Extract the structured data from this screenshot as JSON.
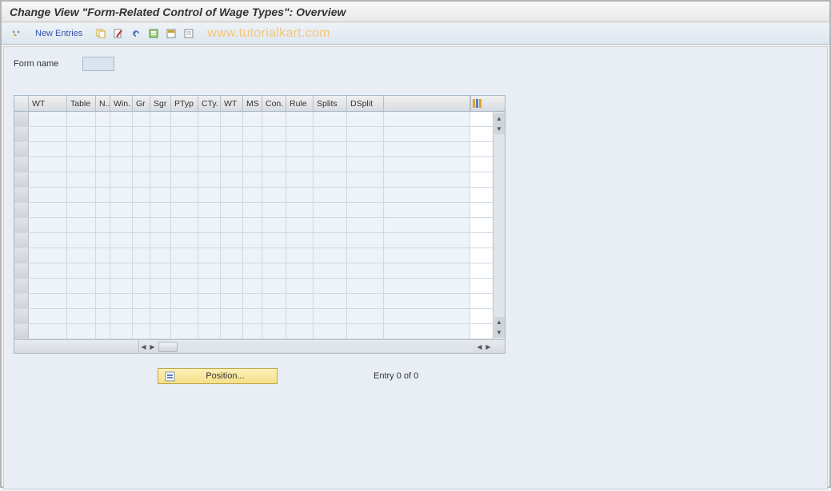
{
  "title": "Change View \"Form-Related Control of Wage Types\": Overview",
  "toolbar": {
    "new_entries": "New Entries"
  },
  "watermark": "www.tutorialkart.com",
  "form": {
    "name_label": "Form name",
    "name_value": ""
  },
  "grid": {
    "columns": [
      "WT",
      "Table",
      "N..",
      "Win.",
      "Gr",
      "Sgr",
      "PTyp",
      "CTy.",
      "WT",
      "MS",
      "Con.",
      "Rule",
      "Splits",
      "DSplit"
    ],
    "row_count": 15
  },
  "footer": {
    "position_label": "Position...",
    "entry_text": "Entry 0 of 0"
  }
}
